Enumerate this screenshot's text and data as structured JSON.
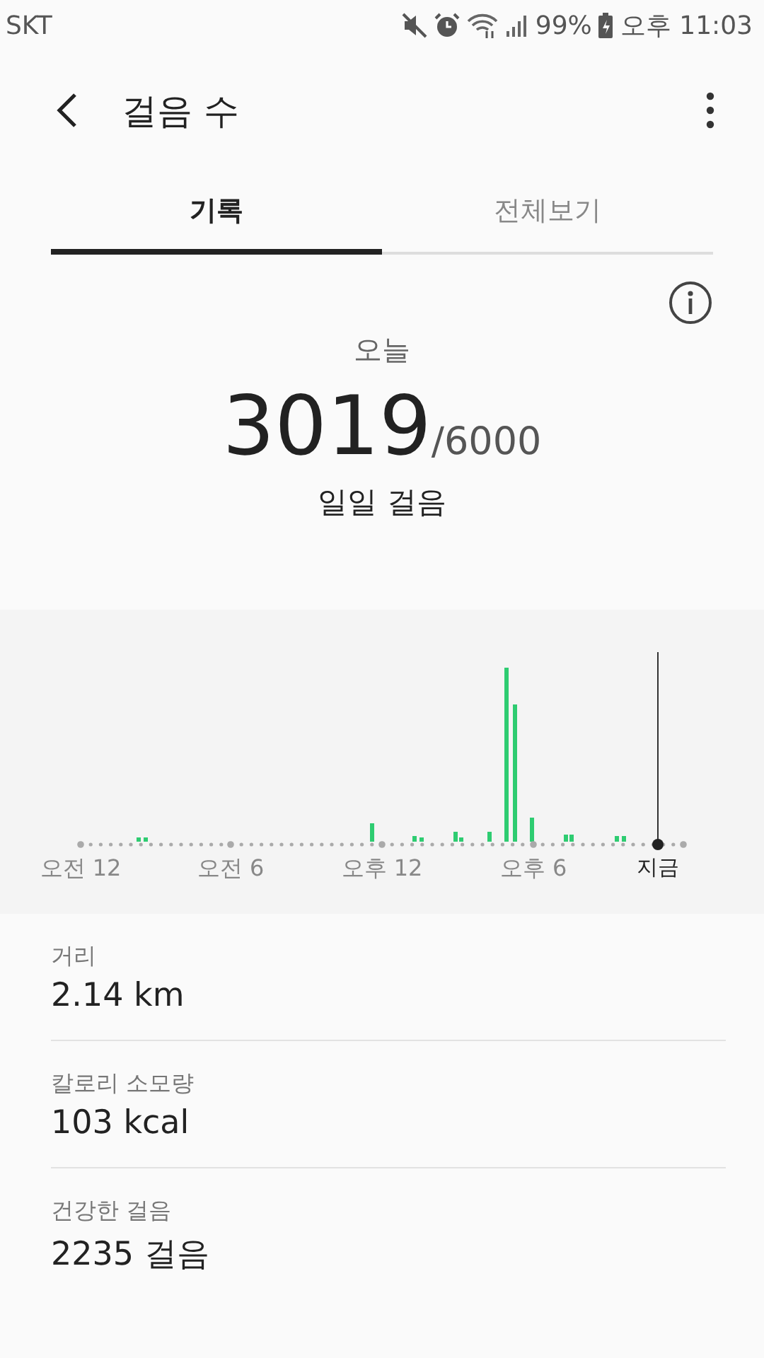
{
  "status_bar": {
    "carrier": "SKT",
    "battery": "99%",
    "time": "오후 11:03"
  },
  "header": {
    "title": "걸음 수"
  },
  "tabs": [
    {
      "label": "기록",
      "selected": true
    },
    {
      "label": "전체보기",
      "selected": false
    }
  ],
  "summary": {
    "day": "오늘",
    "steps": "3019",
    "goal": "/6000",
    "caption": "일일 걸음"
  },
  "chart": {
    "axis_labels": [
      {
        "label": "오전 12",
        "kind": "time"
      },
      {
        "label": "오전 6",
        "kind": "time"
      },
      {
        "label": "오후 12",
        "kind": "time"
      },
      {
        "label": "오후 6",
        "kind": "time"
      },
      {
        "label": "지금",
        "kind": "now"
      }
    ]
  },
  "stats": [
    {
      "label": "거리",
      "value": "2.14 km"
    },
    {
      "label": "칼로리 소모량",
      "value": "103 kcal"
    },
    {
      "label": "건강한 걸음",
      "value": "2235 걸음"
    }
  ]
}
